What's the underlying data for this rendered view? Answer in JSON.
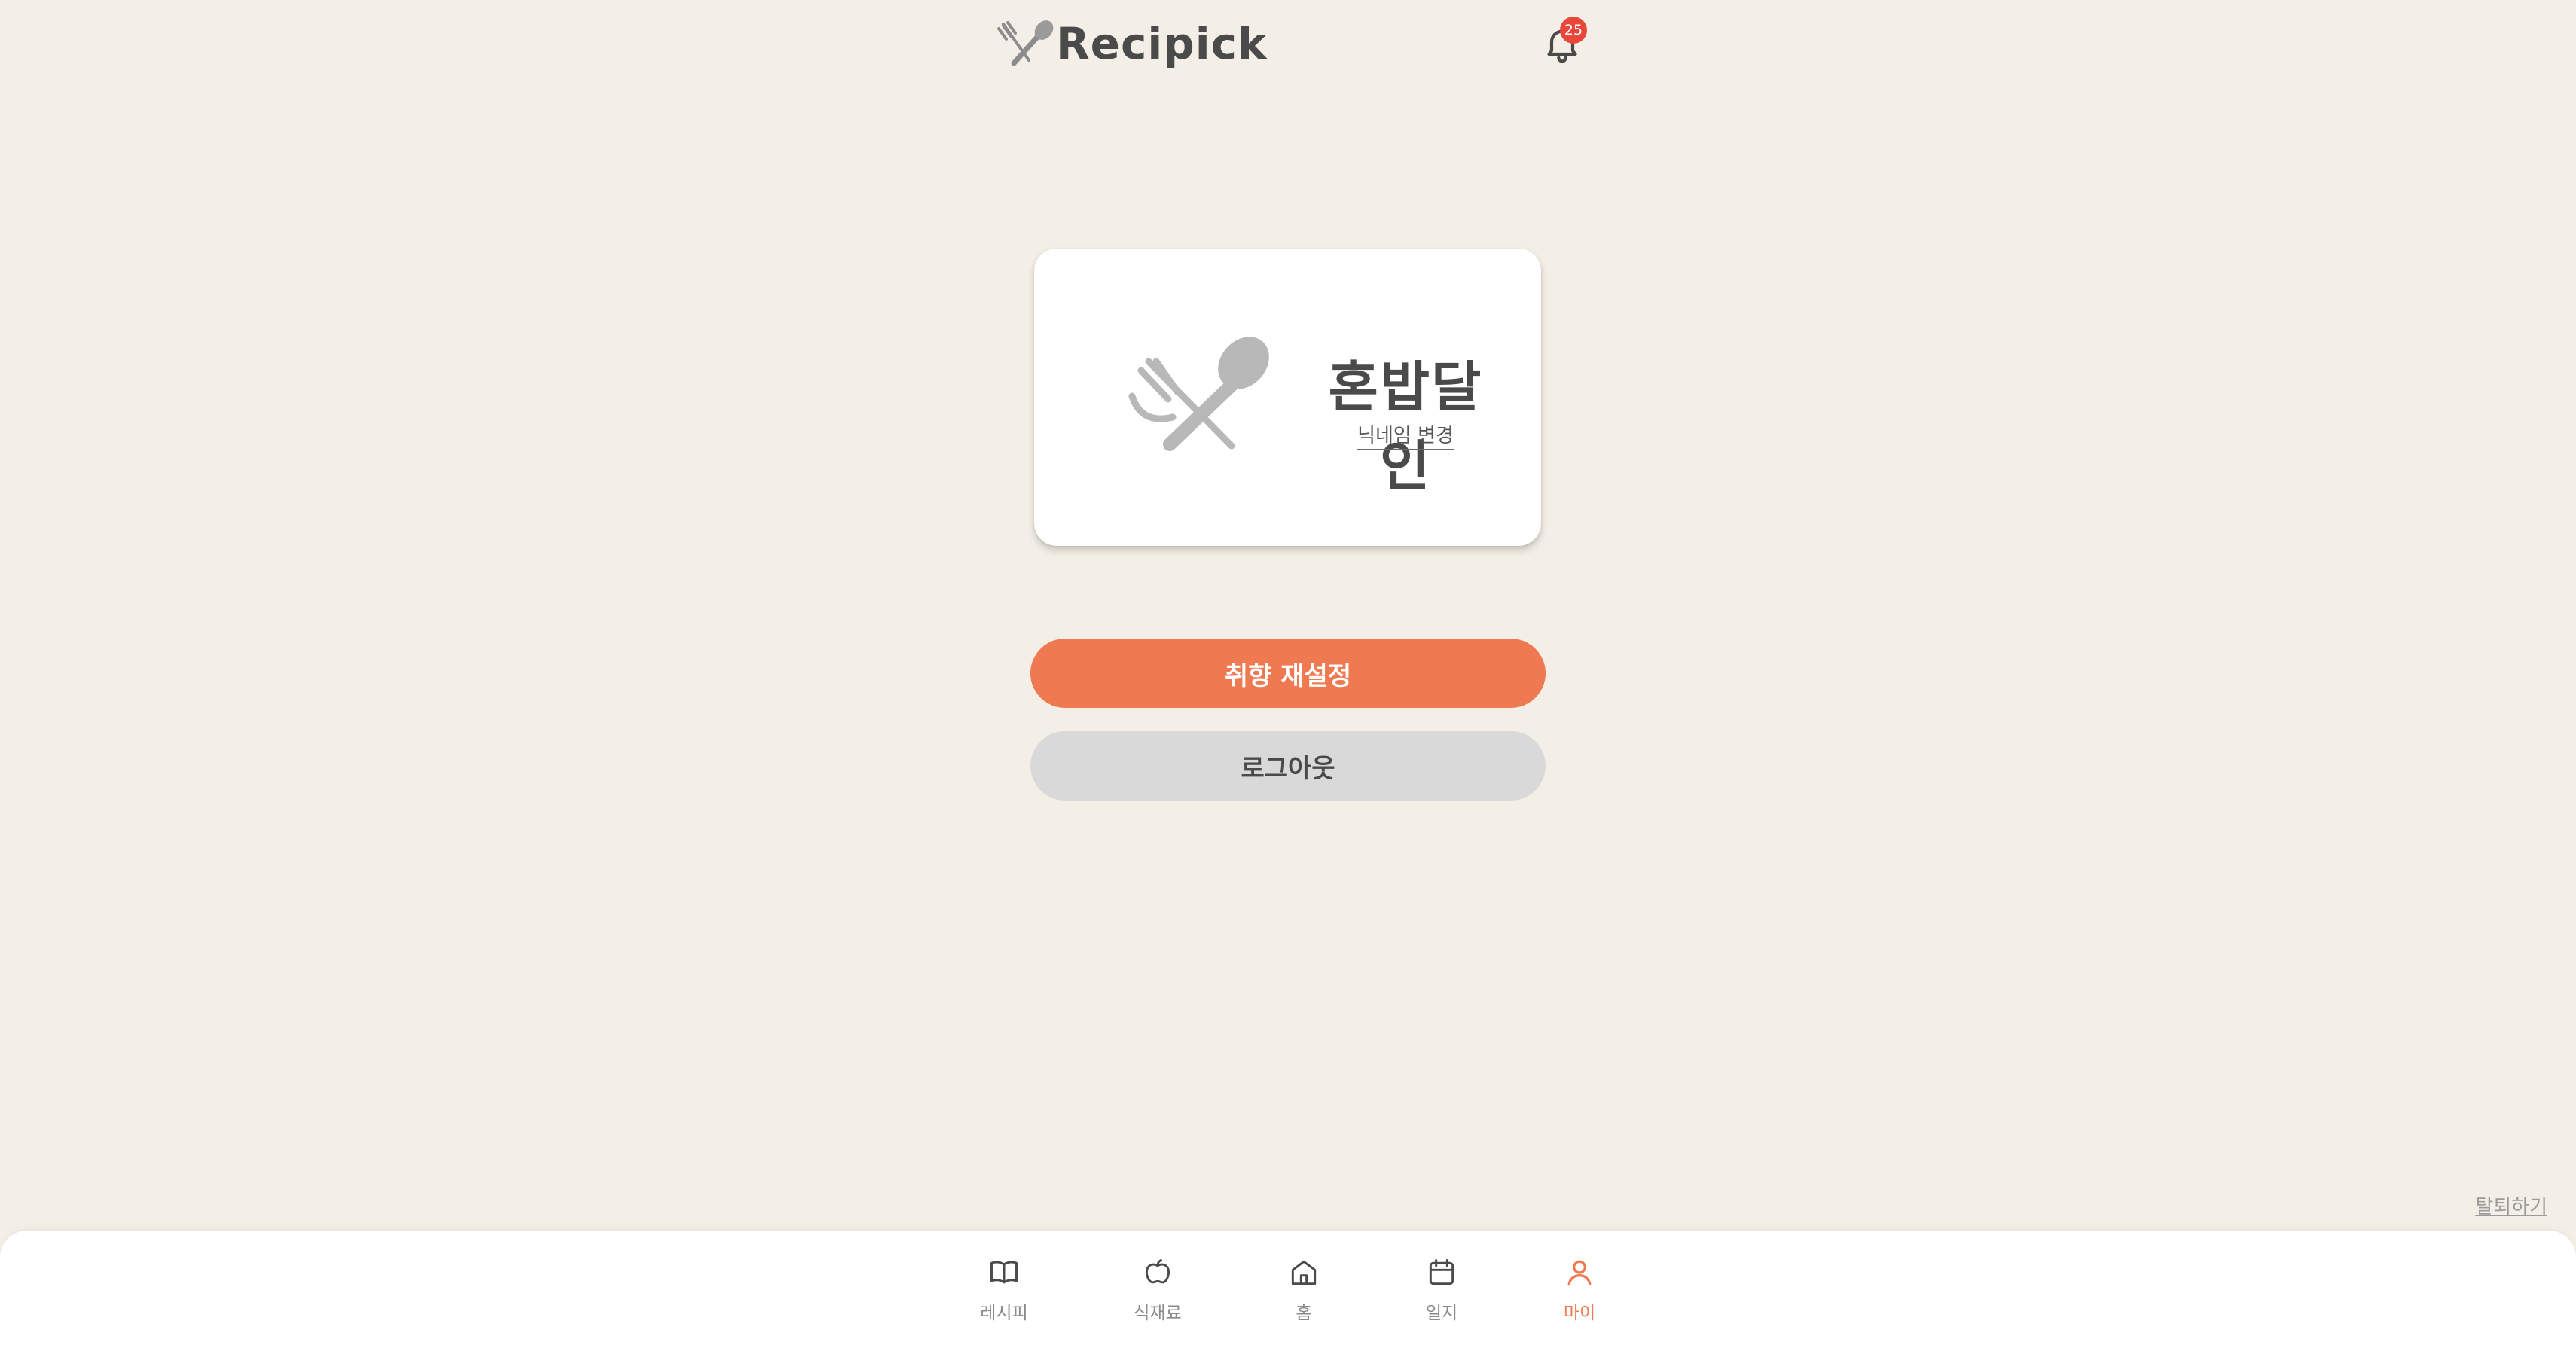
{
  "header": {
    "brand": "Recipick",
    "notification_count": "25"
  },
  "profile": {
    "nickname": "혼밥달인",
    "change_nickname_label": "닉네임 변경"
  },
  "actions": {
    "reset_preferences_label": "취향 재설정",
    "logout_label": "로그아웃"
  },
  "withdraw_label": "탈퇴하기",
  "nav": {
    "items": [
      {
        "label": "레시피",
        "icon": "book-icon"
      },
      {
        "label": "식재료",
        "icon": "apple-icon"
      },
      {
        "label": "홈",
        "icon": "home-icon"
      },
      {
        "label": "일지",
        "icon": "calendar-icon"
      },
      {
        "label": "마이",
        "icon": "user-icon"
      }
    ],
    "active": "마이"
  },
  "colors": {
    "background": "#f4efe6",
    "accent": "#ef7950",
    "badge": "#e8473a",
    "secondary_button": "#d9d9d9",
    "text": "#4a4a4a"
  }
}
